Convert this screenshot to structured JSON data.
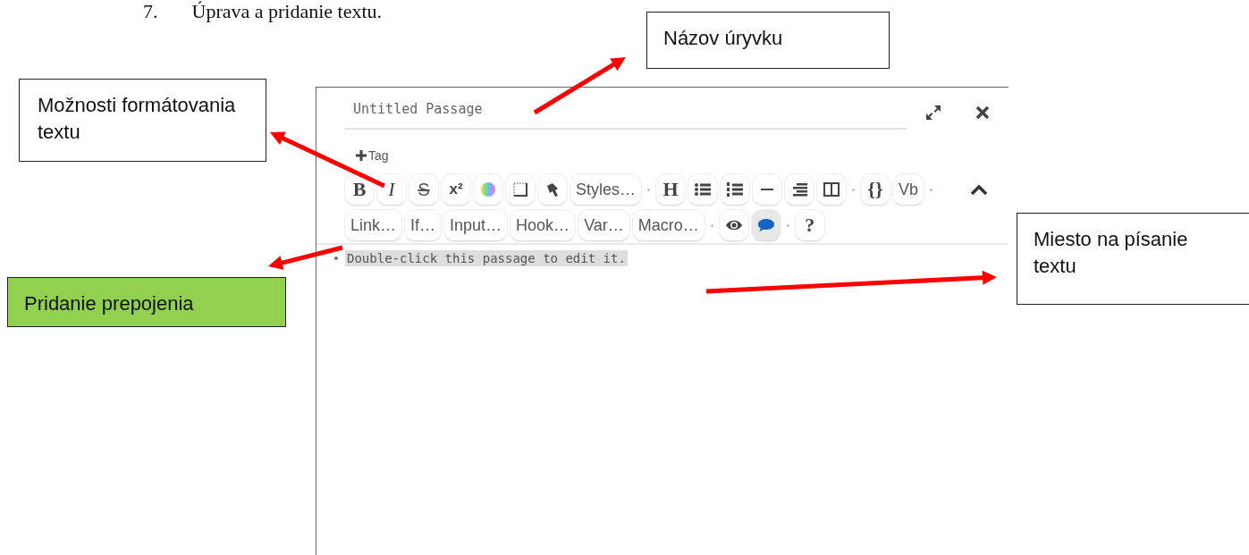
{
  "document": {
    "step_number": "7.",
    "heading": "Úprava a pridanie textu."
  },
  "editor": {
    "title": "Untitled Passage",
    "tag_button": "Tag",
    "toolbar_rows": [
      [
        {
          "kind": "text",
          "label": "B",
          "on": false
        },
        {
          "kind": "text",
          "label": "I",
          "on": false
        },
        {
          "kind": "text",
          "label": "S",
          "on": false
        },
        {
          "kind": "text",
          "label": "x²",
          "on": false
        },
        {
          "kind": "icon",
          "on": false
        },
        {
          "kind": "icon",
          "on": false
        },
        {
          "kind": "icon",
          "on": false
        },
        {
          "kind": "text",
          "label": "Styles…",
          "on": false
        },
        {
          "kind": "sep"
        },
        {
          "kind": "text",
          "label": "H",
          "on": false
        },
        {
          "kind": "icon",
          "on": false
        },
        {
          "kind": "icon",
          "on": false
        },
        {
          "kind": "icon",
          "on": false
        },
        {
          "kind": "icon",
          "on": false
        },
        {
          "kind": "icon",
          "on": false
        },
        {
          "kind": "sep"
        },
        {
          "kind": "text",
          "label": "{}",
          "on": false
        },
        {
          "kind": "text",
          "label": "Vb",
          "on": false
        },
        {
          "kind": "sep"
        }
      ],
      [
        {
          "kind": "text",
          "label": "Link…",
          "on": false
        },
        {
          "kind": "text",
          "label": "If…",
          "on": false
        },
        {
          "kind": "text",
          "label": "Input…",
          "on": false
        },
        {
          "kind": "text",
          "label": "Hook…",
          "on": false
        },
        {
          "kind": "text",
          "label": "Var…",
          "on": false
        },
        {
          "kind": "text",
          "label": "Macro…",
          "on": false
        },
        {
          "kind": "sep"
        },
        {
          "kind": "icon",
          "on": false
        },
        {
          "kind": "icon",
          "on": true
        },
        {
          "kind": "sep"
        },
        {
          "kind": "text",
          "label": "?",
          "on": false
        }
      ]
    ],
    "content": "Double-click this passage to edit it."
  },
  "callouts": [
    {
      "text": "Názov úryvku",
      "color": "#ffffff"
    },
    {
      "text": "Možnosti formátovania textu",
      "color": "#ffffff"
    },
    {
      "text": "Pridanie prepojenia",
      "color": "#92d050"
    },
    {
      "text": "Miesto na písanie textu",
      "color": "#ffffff"
    }
  ]
}
